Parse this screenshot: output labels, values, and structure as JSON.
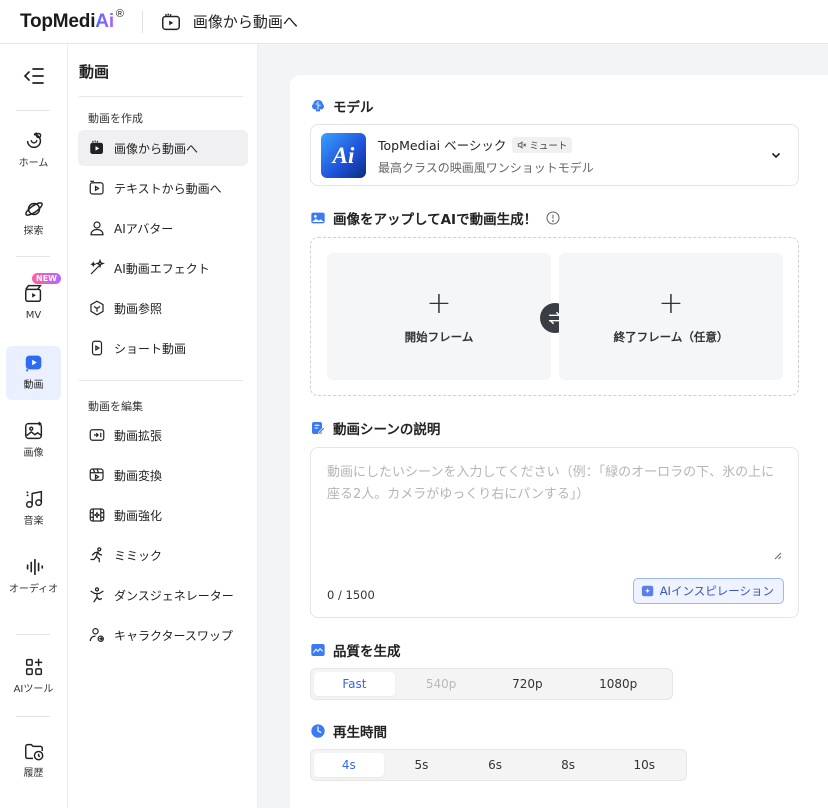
{
  "header": {
    "logo_main": "TopMedi",
    "logo_ai": "Ai",
    "logo_mark": "®",
    "page_title": "画像から動画へ"
  },
  "rail": {
    "items": [
      {
        "label": "ホーム",
        "icon": "home-icon"
      },
      {
        "label": "探索",
        "icon": "planet-icon"
      },
      {
        "label": "MV",
        "icon": "mv-icon",
        "badge": "NEW"
      },
      {
        "label": "動画",
        "icon": "video-icon",
        "active": true
      },
      {
        "label": "画像",
        "icon": "image-icon"
      },
      {
        "label": "音楽",
        "icon": "music-icon"
      },
      {
        "label": "オーディオ",
        "icon": "audio-icon"
      },
      {
        "label": "AIツール",
        "icon": "tools-icon"
      },
      {
        "label": "履歴",
        "icon": "history-icon"
      }
    ]
  },
  "submenu": {
    "title": "動画",
    "group_create": "動画を作成",
    "create_items": [
      {
        "label": "画像から動画へ",
        "active": true
      },
      {
        "label": "テキストから動画へ"
      },
      {
        "label": "AIアバター"
      },
      {
        "label": "AI動画エフェクト"
      },
      {
        "label": "動画参照"
      },
      {
        "label": "ショート動画"
      }
    ],
    "group_edit": "動画を編集",
    "edit_items": [
      {
        "label": "動画拡張"
      },
      {
        "label": "動画変換"
      },
      {
        "label": "動画強化"
      },
      {
        "label": "ミミック"
      },
      {
        "label": "ダンスジェネレーター"
      },
      {
        "label": "キャラクタースワップ"
      }
    ]
  },
  "model": {
    "section_title": "モデル",
    "thumb_text": "Ai",
    "name": "TopMediai ベーシック",
    "mute": "ミュート",
    "desc": "最高クラスの映画風ワンショットモデル"
  },
  "upload": {
    "section_title": "画像をアップしてAIで動画生成！",
    "start_frame": "開始フレーム",
    "end_frame": "終了フレーム（任意）"
  },
  "scene": {
    "section_title": "動画シーンの説明",
    "placeholder": "動画にしたいシーンを入力してください（例：「緑のオーロラの下、氷の上に座る2人。カメラがゆっくり右にパンする」）",
    "counter": "0 / 1500",
    "inspiration": "AIインスピレーション"
  },
  "quality": {
    "section_title": "品質を生成",
    "options": [
      "Fast",
      "540p",
      "720p",
      "1080p"
    ],
    "selected": "Fast",
    "disabled": [
      "540p"
    ]
  },
  "duration": {
    "section_title": "再生時間",
    "options": [
      "4s",
      "5s",
      "6s",
      "8s",
      "10s"
    ],
    "selected": "4s"
  },
  "colors": {
    "accent": "#3867e8",
    "active_rail_bg": "#eaf0ff"
  }
}
